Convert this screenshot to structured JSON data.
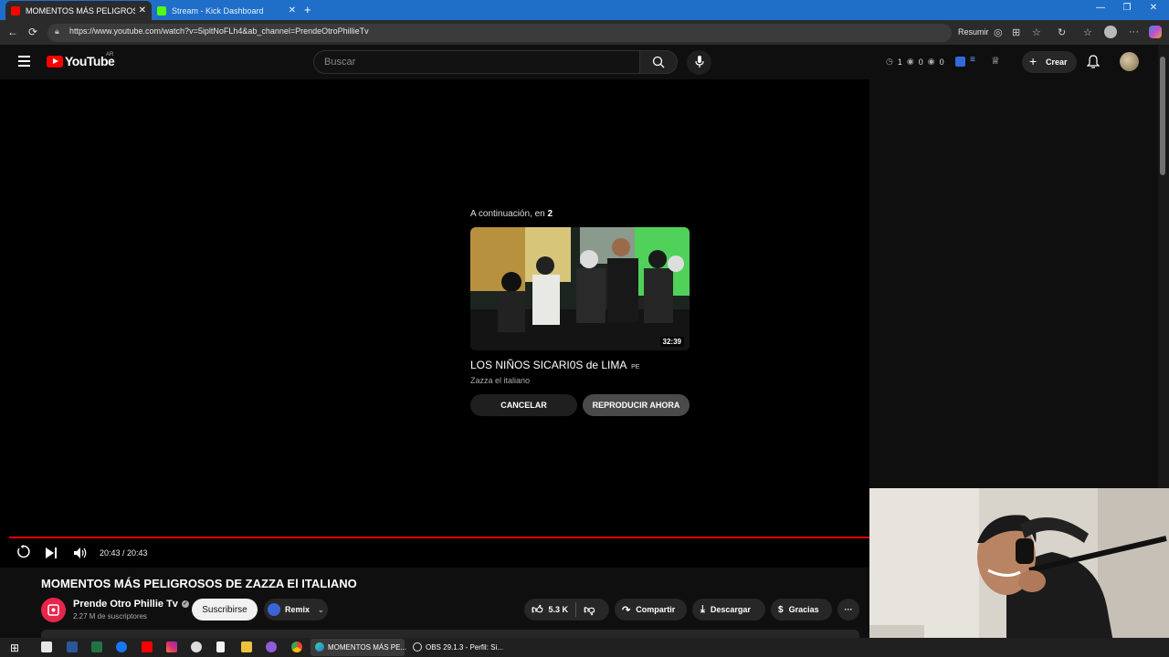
{
  "browser": {
    "tabs": [
      {
        "title": "MOMENTOS MÁS PELIGROSOS D",
        "close": "✕"
      },
      {
        "title": "Stream - Kick Dashboard",
        "close": "✕"
      }
    ],
    "new_tab": "+",
    "url": "https://www.youtube.com/watch?v=5ipltNoFLh4&ab_channel=PrendeOtroPhillieTv",
    "resumir_label": "Resumir"
  },
  "youtube": {
    "logo_text": "YouTube",
    "region": "AR",
    "search_placeholder": "Buscar",
    "header_stats": {
      "a": "1",
      "b": "0",
      "c": "0"
    },
    "create_label": "Crear"
  },
  "upnext": {
    "prefix": "A continuación, en ",
    "countdown": "2",
    "duration": "32:39",
    "title": "LOS NIÑOS SICARI0S de LIMA",
    "flag": "PE",
    "channel": "Zazza el italiano",
    "cancel_label": "CANCELAR",
    "play_label": "REPRODUCIR AHORA"
  },
  "player": {
    "time": "20:43 / 20:43",
    "progress": 1.0
  },
  "video": {
    "title": "MOMENTOS MÁS PELIGROSOS DE ZAZZA El ITALIANO",
    "channel": "Prende Otro Phillie Tv",
    "subscribers": "2.27 M de suscriptores",
    "subscribe_label": "Suscribirse",
    "remix_label": "Remix",
    "likes": "5.3 K",
    "share_label": "Compartir",
    "download_label": "Descargar",
    "thanks_label": "Gracias",
    "more": "···"
  },
  "taskbar": {
    "items": [
      {
        "title": "MOMENTOS MÁS PE..."
      },
      {
        "title": "OBS 29.1.3 - Perfil: Si..."
      }
    ]
  }
}
